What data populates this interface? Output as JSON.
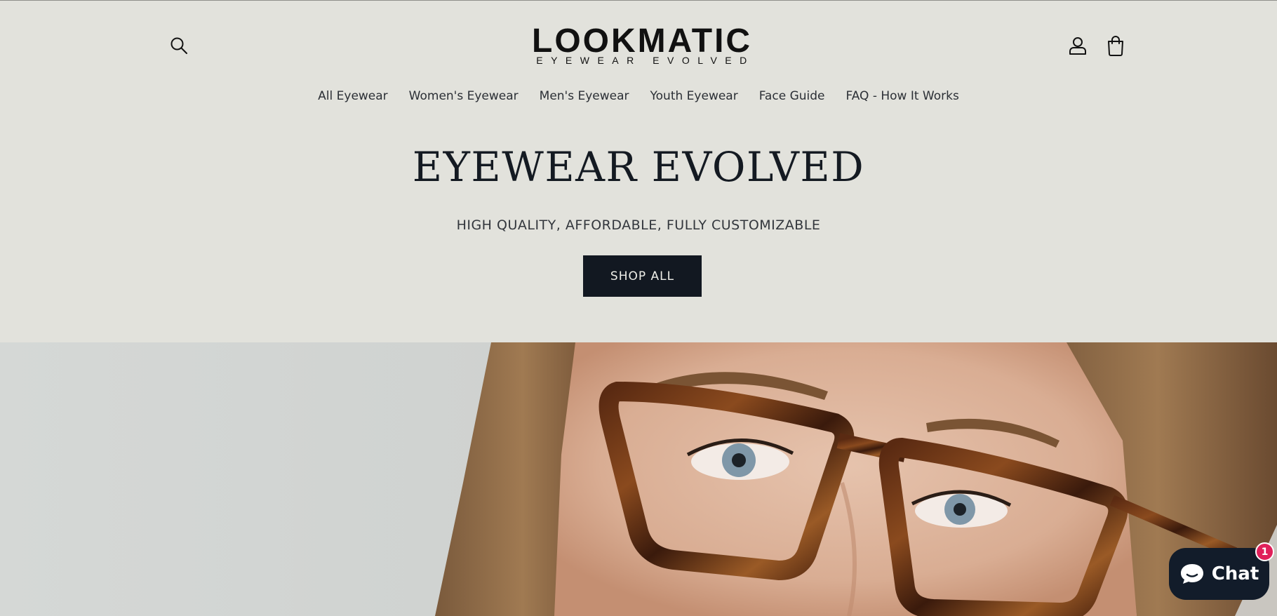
{
  "brand": {
    "name": "LOOKMATIC",
    "tagline": "EYEWEAR EVOLVED"
  },
  "header": {
    "icons": {
      "search": "search-icon",
      "account": "user-icon",
      "cart": "bag-icon"
    }
  },
  "nav": {
    "items": [
      {
        "label": "All Eyewear"
      },
      {
        "label": "Women's Eyewear"
      },
      {
        "label": "Men's Eyewear"
      },
      {
        "label": "Youth Eyewear"
      },
      {
        "label": "Face Guide"
      },
      {
        "label": "FAQ - How It Works"
      }
    ]
  },
  "hero": {
    "title": "EYEWEAR EVOLVED",
    "subtitle": "HIGH QUALITY, AFFORDABLE, FULLY CUSTOMIZABLE",
    "cta_label": "SHOP ALL"
  },
  "chat": {
    "label": "Chat",
    "badge_count": "1"
  },
  "colors": {
    "background": "#e2e2dc",
    "button": "#121821",
    "chat_bg": "#121c2a",
    "badge": "#e0205a"
  }
}
